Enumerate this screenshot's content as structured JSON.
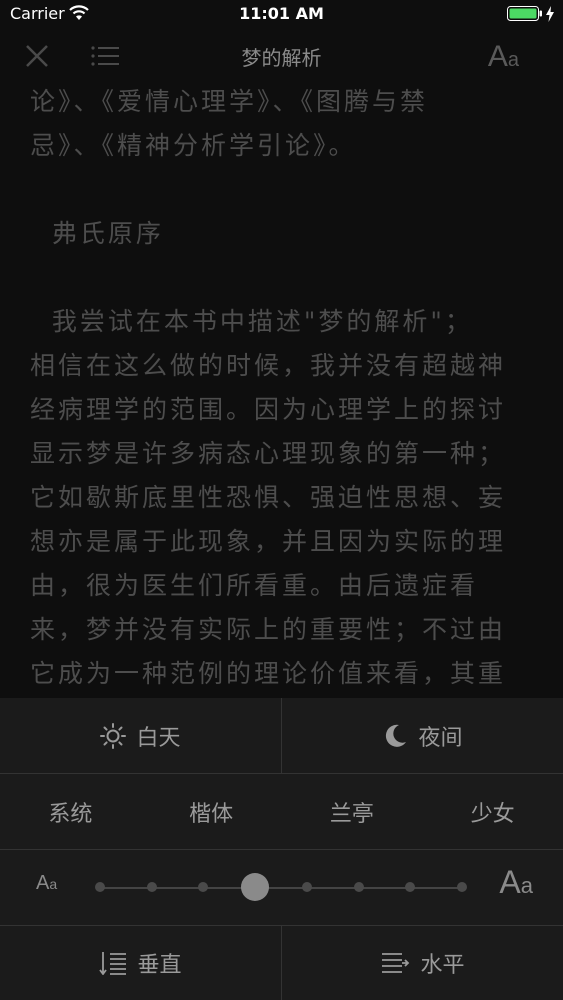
{
  "status_bar": {
    "carrier": "Carrier",
    "time": "11:01 AM"
  },
  "nav": {
    "title": "梦的解析",
    "font_button_big": "A",
    "font_button_small": "a"
  },
  "reader": {
    "lines": [
      "论》、《爱情心理学》、《图腾与禁",
      "忌》、《精神分析学引论》。",
      "",
      "  弗氏原序",
      "",
      "  我尝试在本书中描述\"梦的解析\"；",
      "相信在这么做的时候，我并没有超越神",
      "经病理学的范围。因为心理学上的探讨",
      "显示梦是许多病态心理现象的第一种；",
      "它如歇斯底里性恐惧、强迫性思想、妄",
      "想亦是属于此现象，并且因为实际的理",
      "由，很为医生们所看重。由后遗症看",
      "来，梦并没有实际上的重要性；不过由",
      "它成为一种范例的理论价值来看，其重"
    ]
  },
  "panel": {
    "day_label": "白天",
    "night_label": "夜间",
    "fonts": [
      "系统",
      "楷体",
      "兰亭",
      "少女"
    ],
    "size_small": {
      "a1": "A",
      "a2": "a"
    },
    "size_big": {
      "a1": "A",
      "a2": "a"
    },
    "size_slider": {
      "steps": 8,
      "selected_index": 3
    },
    "vertical_label": "垂直",
    "horizontal_label": "水平"
  },
  "colors": {
    "background": "#0e0e0e",
    "panel": "#1b1b1b",
    "battery": "#4cd964"
  }
}
